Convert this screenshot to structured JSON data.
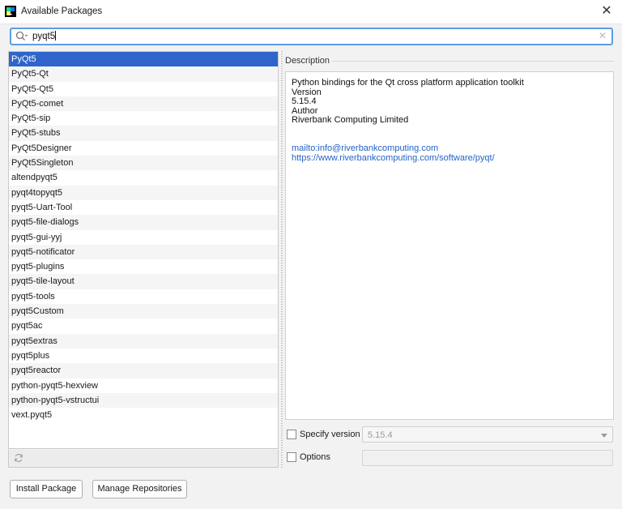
{
  "window": {
    "title": "Available Packages"
  },
  "search": {
    "value": "pyqt5"
  },
  "packages": [
    "PyQt5",
    "PyQt5-Qt",
    "PyQt5-Qt5",
    "PyQt5-comet",
    "PyQt5-sip",
    "PyQt5-stubs",
    "PyQt5Designer",
    "PyQt5Singleton",
    "altendpyqt5",
    "pyqt4topyqt5",
    "pyqt5-Uart-Tool",
    "pyqt5-file-dialogs",
    "pyqt5-gui-yyj",
    "pyqt5-notificator",
    "pyqt5-plugins",
    "pyqt5-tile-layout",
    "pyqt5-tools",
    "pyqt5Custom",
    "pyqt5ac",
    "pyqt5extras",
    "pyqt5plus",
    "pyqt5reactor",
    "python-pyqt5-hexview",
    "python-pyqt5-vstructui",
    "vext.pyqt5"
  ],
  "selected_index": 0,
  "description": {
    "label": "Description",
    "summary": "Python bindings for the Qt cross platform application toolkit",
    "version_label": "Version",
    "version": "5.15.4",
    "author_label": "Author",
    "author": "Riverbank Computing Limited",
    "email_link": "mailto:info@riverbankcomputing.com",
    "url_link": "https://www.riverbankcomputing.com/software/pyqt/"
  },
  "specify_version": {
    "label": "Specify version",
    "value": "5.15.4",
    "checked": false
  },
  "options": {
    "label": "Options",
    "value": "",
    "checked": false
  },
  "buttons": {
    "install": "Install Package",
    "manage": "Manage Repositories"
  },
  "icons": {
    "app": "pycharm-icon",
    "close": "close-icon",
    "search": "search-icon",
    "clear": "clear-icon",
    "refresh": "refresh-icon",
    "dropdown": "chevron-down-icon"
  },
  "colors": {
    "selection": "#2f65ca",
    "focus": "#5d9cec",
    "link": "#2463c7"
  }
}
